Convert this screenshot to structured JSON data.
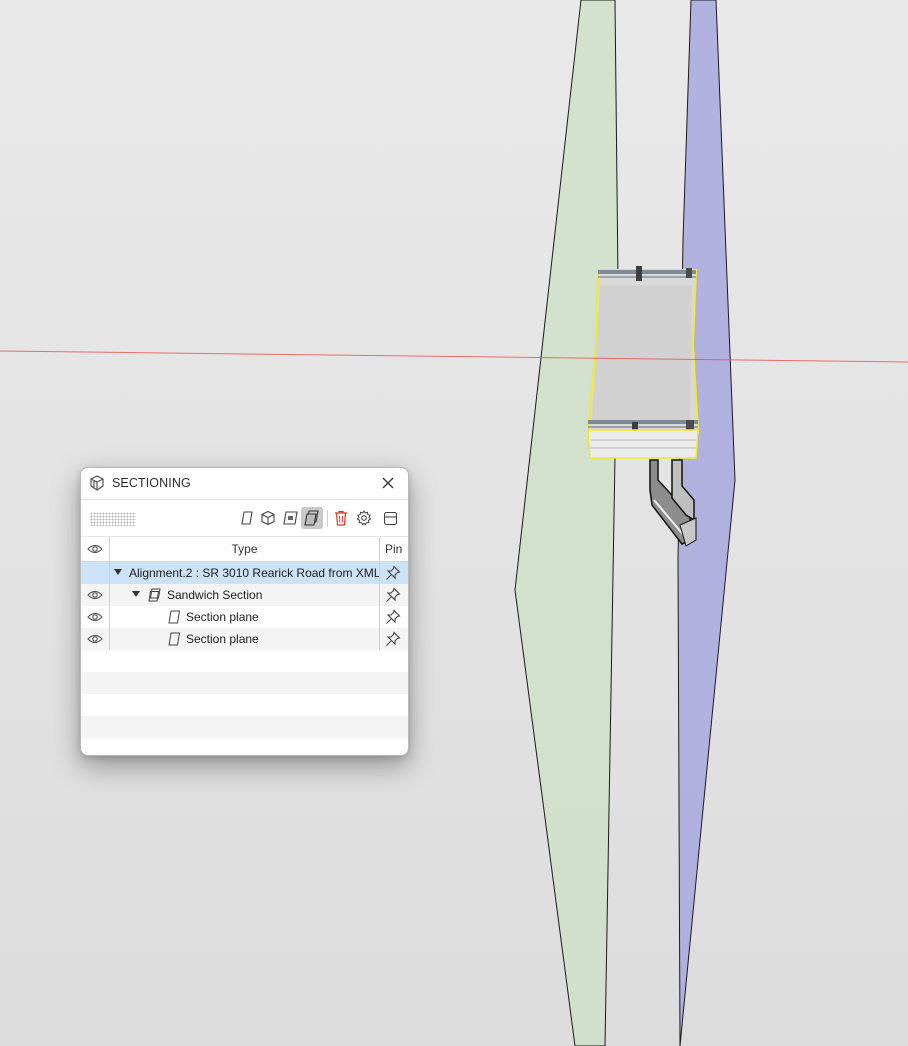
{
  "panel": {
    "title": "SECTIONING",
    "columns": {
      "type": "Type",
      "pin": "Pin"
    },
    "toolbar": {
      "icons": [
        "section-plane-icon",
        "section-box-icon",
        "section-slice-icon",
        "sandwich-section-icon",
        "delete-icon",
        "settings-icon",
        "panel-layout-icon"
      ],
      "active": "sandwich-section-icon"
    },
    "rows": [
      {
        "label": "Alignment.2 : SR 3010 Rearick Road from XML",
        "selected": true,
        "expanded": true
      },
      {
        "label": "Sandwich Section",
        "expanded": true
      },
      {
        "label": "Section plane"
      },
      {
        "label": "Section plane"
      }
    ]
  },
  "colors": {
    "selection": "#cce2f7",
    "plane_green": "#c8dcc2",
    "plane_blue": "#9a9ad6",
    "axis_red": "#e8504a",
    "highlight_yellow": "#f2ea2a",
    "delete_red": "#d9342b"
  }
}
